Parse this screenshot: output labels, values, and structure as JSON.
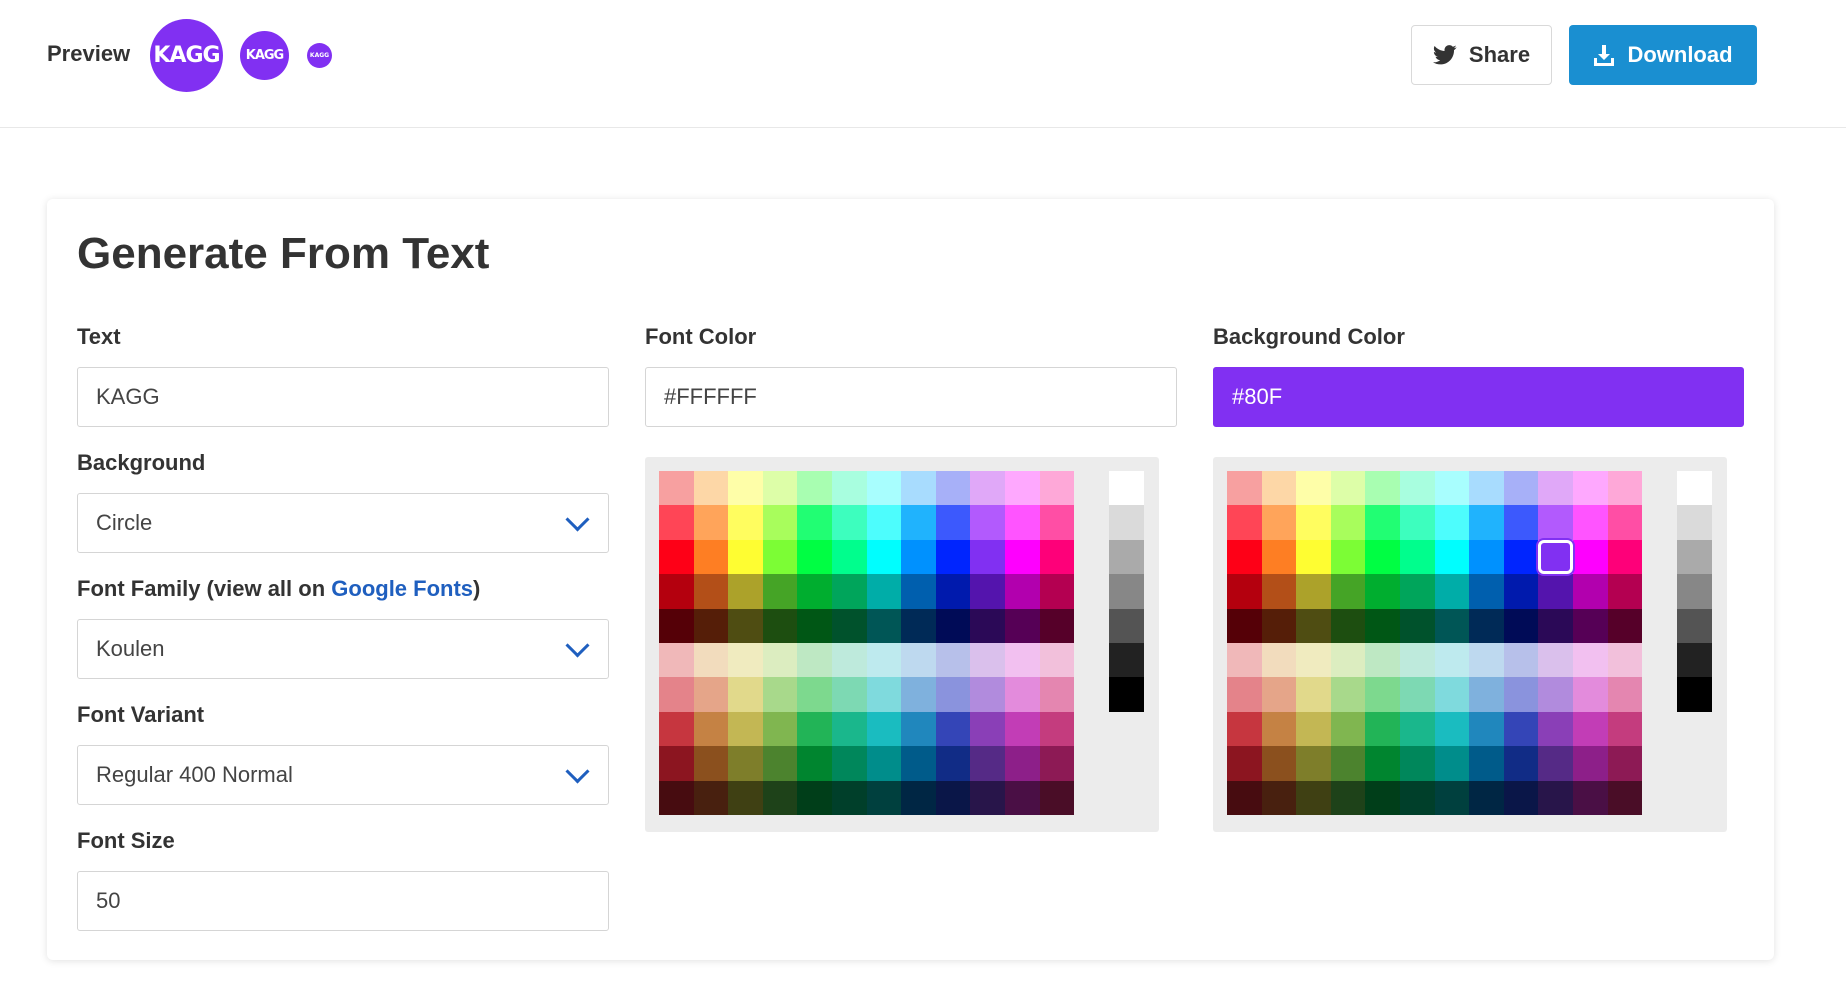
{
  "header": {
    "preview_label": "Preview",
    "avatar_text": "KAGG",
    "avatar_color": "#8130f2",
    "share_label": "Share",
    "download_label": "Download"
  },
  "form": {
    "title": "Generate From Text",
    "text": {
      "label": "Text",
      "value": "KAGG"
    },
    "background": {
      "label": "Background",
      "value": "Circle"
    },
    "font_family": {
      "label_prefix": "Font Family (view all on ",
      "link_text": "Google Fonts",
      "label_suffix": ")",
      "value": "Koulen"
    },
    "font_variant": {
      "label": "Font Variant",
      "value": "Regular 400 Normal"
    },
    "font_size": {
      "label": "Font Size",
      "value": "50"
    },
    "font_color": {
      "label": "Font Color",
      "value": "#FFFFFF"
    },
    "background_color": {
      "label": "Background Color",
      "value": "#80F"
    }
  },
  "palette": {
    "hues": [
      [
        "#f7a0a0",
        "#fdd7a7",
        "#fefea8",
        "#ddfea8",
        "#a8feb1",
        "#a8fedf",
        "#a8fefe",
        "#a8dcfe",
        "#a7b0f8",
        "#e0a8f8",
        "#fea8fe",
        "#fea8d8"
      ],
      [
        "#ff4556",
        "#ffa45a",
        "#fffd5f",
        "#a8fd5c",
        "#21fe73",
        "#3dfebe",
        "#4dfdfd",
        "#20b3fd",
        "#3c59fd",
        "#b25afd",
        "#ff54ff",
        "#ff4ea5"
      ],
      [
        "#fe0017",
        "#fe7e23",
        "#fefd32",
        "#7cfd35",
        "#00fe43",
        "#00fe8d",
        "#00fefe",
        "#0091fe",
        "#0025fe",
        "#8130f2",
        "#fe00fe",
        "#fe0079"
      ],
      [
        "#b4000e",
        "#b34f18",
        "#aca22a",
        "#45a426",
        "#00ae2f",
        "#00a55b",
        "#00ada8",
        "#005fae",
        "#001aad",
        "#5414ad",
        "#b200ae",
        "#b40051"
      ],
      [
        "#550007",
        "#551e08",
        "#4f4d12",
        "#1d4e10",
        "#005715",
        "#00522c",
        "#005656",
        "#002a57",
        "#000b57",
        "#2b0957",
        "#560056",
        "#560029"
      ],
      [
        "#f0b8b9",
        "#f2dcbd",
        "#f0ebbf",
        "#dcedc0",
        "#bee8c3",
        "#beeadc",
        "#beeaee",
        "#bed9ef",
        "#b7c0ea",
        "#dac0ec",
        "#f2c0f0",
        "#f2c0db"
      ],
      [
        "#e4838a",
        "#e5a589",
        "#e1d98b",
        "#a8d98b",
        "#7dd98e",
        "#7dd9b3",
        "#7fdadd",
        "#7fb1dd",
        "#8a93dd",
        "#b18bdd",
        "#e38bdc",
        "#e486b0"
      ],
      [
        "#c6363f",
        "#c58244",
        "#c3b754",
        "#80b650",
        "#22b457",
        "#1ab78c",
        "#1abcc0",
        "#2087bd",
        "#3445b7",
        "#8a3fb7",
        "#c23db6",
        "#c43c7e"
      ],
      [
        "#8c1520",
        "#8b501e",
        "#7e7e2a",
        "#4c832e",
        "#00852f",
        "#00875b",
        "#008d8b",
        "#005b8a",
        "#112c86",
        "#552a86",
        "#8d1f89",
        "#8d1a55"
      ],
      [
        "#470c10",
        "#48200f",
        "#3f4013",
        "#1e4219",
        "#003e19",
        "#003f2a",
        "#00403e",
        "#002644",
        "#0a1648",
        "#28154a",
        "#4a0f45",
        "#4a0d27"
      ]
    ],
    "grays": [
      "#ffffff",
      "#dadada",
      "#aaaaaa",
      "#878787",
      "#545454",
      "#222222",
      "#000000"
    ],
    "selected": "#8130f2"
  }
}
